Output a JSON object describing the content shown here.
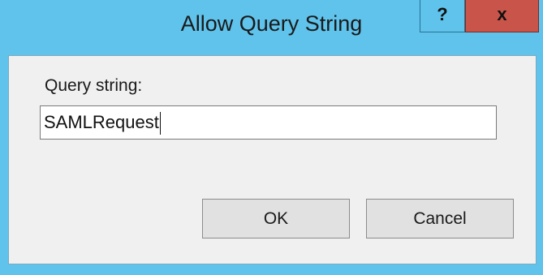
{
  "window": {
    "title": "Allow Query String",
    "help_label": "?",
    "close_label": "x",
    "titlebar_color": "#5fc3ec",
    "close_color": "#c9544a"
  },
  "form": {
    "query_label": "Query string:",
    "query_value": "SAMLRequest"
  },
  "buttons": {
    "ok_label": "OK",
    "cancel_label": "Cancel"
  }
}
